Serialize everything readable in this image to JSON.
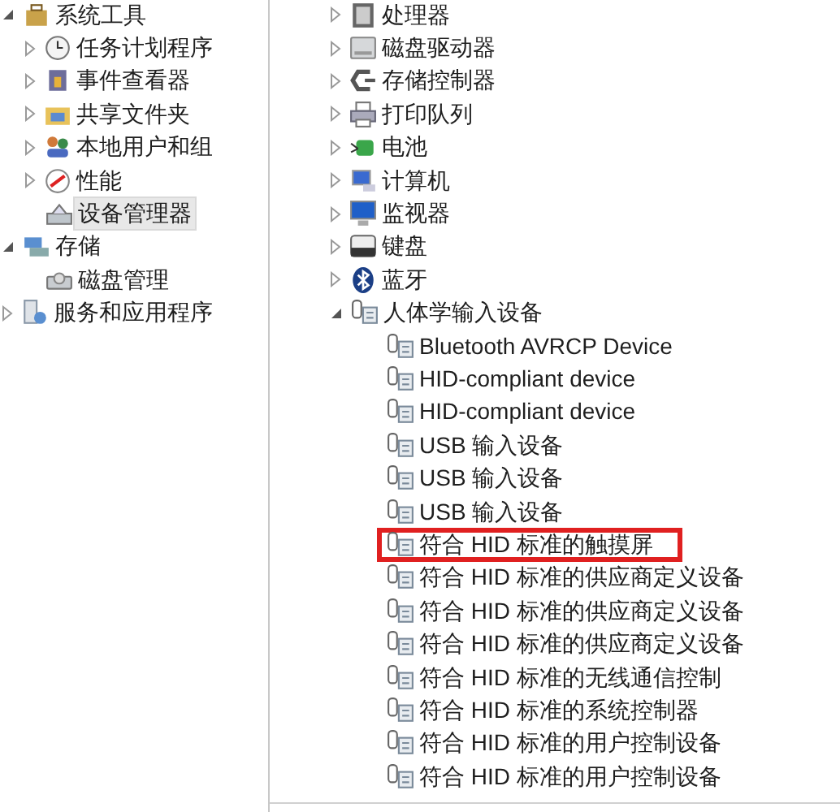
{
  "left_tree": [
    {
      "label": "系统工具",
      "expanded": true,
      "selected": false,
      "children": [
        {
          "label": "任务计划程序",
          "expanded": false,
          "selected": false
        },
        {
          "label": "事件查看器",
          "expanded": false,
          "selected": false
        },
        {
          "label": "共享文件夹",
          "expanded": false,
          "selected": false
        },
        {
          "label": "本地用户和组",
          "expanded": false,
          "selected": false
        },
        {
          "label": "性能",
          "expanded": false,
          "selected": false
        },
        {
          "label": "设备管理器",
          "selected": true
        }
      ]
    },
    {
      "label": "存储",
      "expanded": true,
      "selected": false,
      "children": [
        {
          "label": "磁盘管理",
          "selected": false
        }
      ]
    },
    {
      "label": "服务和应用程序",
      "expanded": false,
      "selected": false
    }
  ],
  "device_tree": [
    {
      "label": "处理器",
      "expanded": false
    },
    {
      "label": "磁盘驱动器",
      "expanded": false
    },
    {
      "label": "存储控制器",
      "expanded": false
    },
    {
      "label": "打印队列",
      "expanded": false
    },
    {
      "label": "电池",
      "expanded": false
    },
    {
      "label": "计算机",
      "expanded": false
    },
    {
      "label": "监视器",
      "expanded": false
    },
    {
      "label": "键盘",
      "expanded": false
    },
    {
      "label": "蓝牙",
      "expanded": false
    },
    {
      "label": "人体学输入设备",
      "expanded": true,
      "children": [
        {
          "label": "Bluetooth AVRCP Device",
          "highlighted": false
        },
        {
          "label": "HID-compliant device",
          "highlighted": false
        },
        {
          "label": "HID-compliant device",
          "highlighted": false
        },
        {
          "label": "USB 输入设备",
          "highlighted": false
        },
        {
          "label": "USB 输入设备",
          "highlighted": false
        },
        {
          "label": "USB 输入设备",
          "highlighted": false
        },
        {
          "label": "符合 HID 标准的触摸屏",
          "highlighted": true
        },
        {
          "label": "符合 HID 标准的供应商定义设备",
          "highlighted": false
        },
        {
          "label": "符合 HID 标准的供应商定义设备",
          "highlighted": false
        },
        {
          "label": "符合 HID 标准的供应商定义设备",
          "highlighted": false
        },
        {
          "label": "符合 HID 标准的无线通信控制",
          "highlighted": false
        },
        {
          "label": "符合 HID 标准的系统控制器",
          "highlighted": false
        },
        {
          "label": "符合 HID 标准的用户控制设备",
          "highlighted": false
        },
        {
          "label": "符合 HID 标准的用户控制设备",
          "highlighted": false
        }
      ]
    }
  ]
}
